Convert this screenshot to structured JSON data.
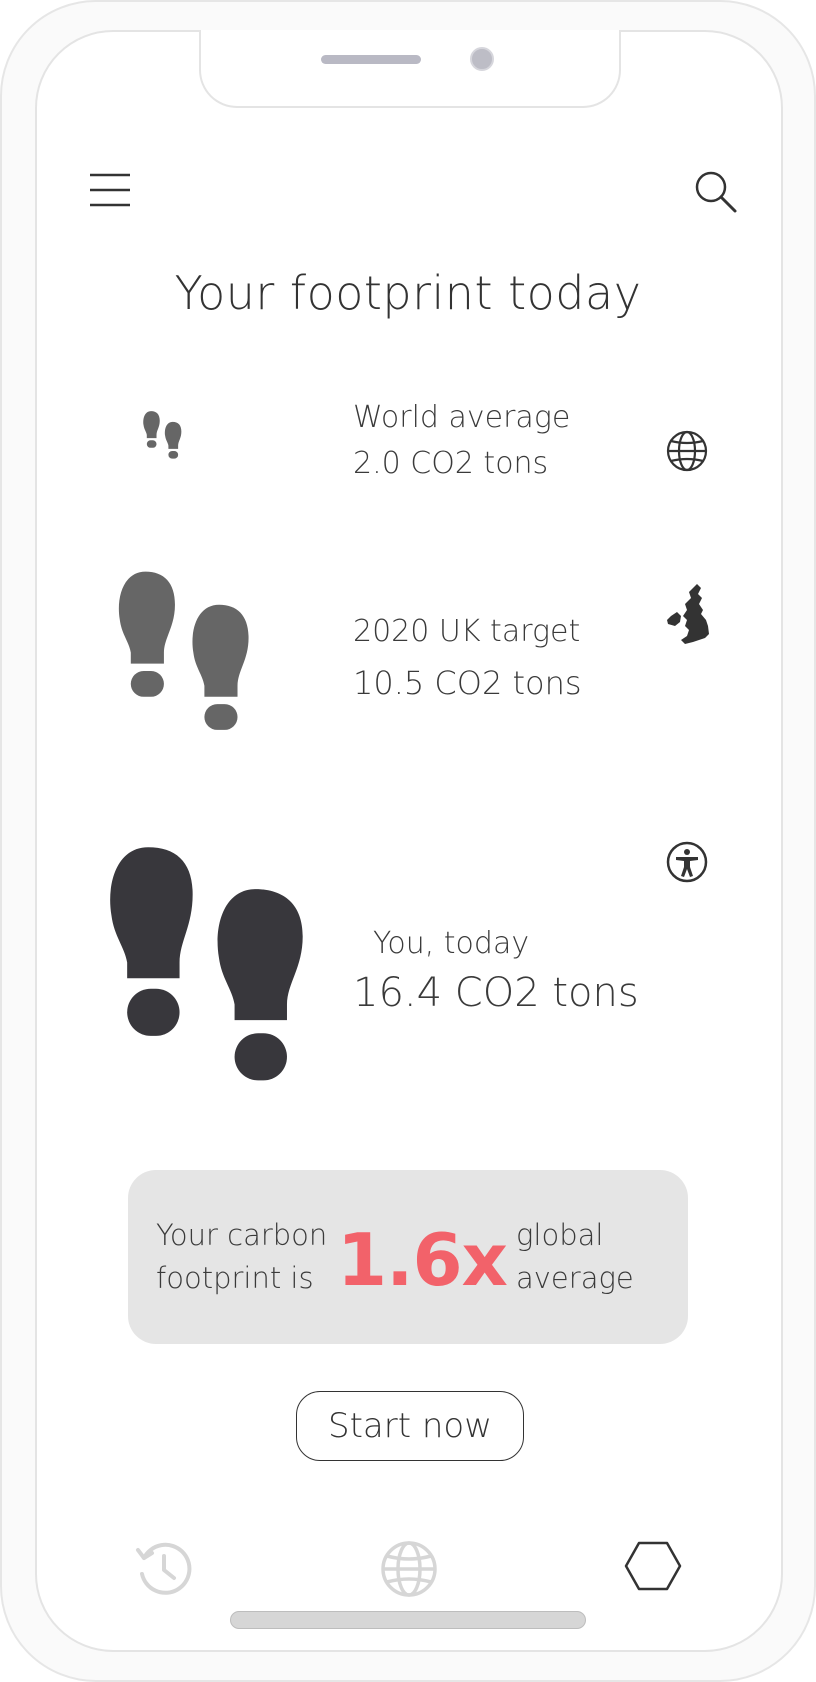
{
  "header": {
    "title": "Your footprint today",
    "menu_icon": "hamburger-menu-icon",
    "search_icon": "search-icon"
  },
  "stats": [
    {
      "label": "World average",
      "value": "2.0 CO2 tons",
      "icon": "globe-icon"
    },
    {
      "label": "2020 UK target",
      "value": "10.5 CO2 tons",
      "icon": "uk-map-icon"
    },
    {
      "label": "You, today",
      "value": "16.4 CO2 tons",
      "icon": "accessibility-person-icon"
    }
  ],
  "summary": {
    "left_line1": "Your carbon",
    "left_line2": "footprint is",
    "multiplier": "1.6x",
    "right_line1": "global",
    "right_line2": "average"
  },
  "cta": {
    "label": "Start now"
  },
  "bottom_nav": [
    {
      "icon": "history-icon"
    },
    {
      "icon": "globe-icon"
    },
    {
      "icon": "hexagon-icon"
    }
  ],
  "colors": {
    "accent": "#f2626a",
    "card_bg": "#e5e5e5",
    "footprint_light": "#666666",
    "footprint_dark": "#38373c",
    "nav_inactive": "#d6d6d6"
  }
}
